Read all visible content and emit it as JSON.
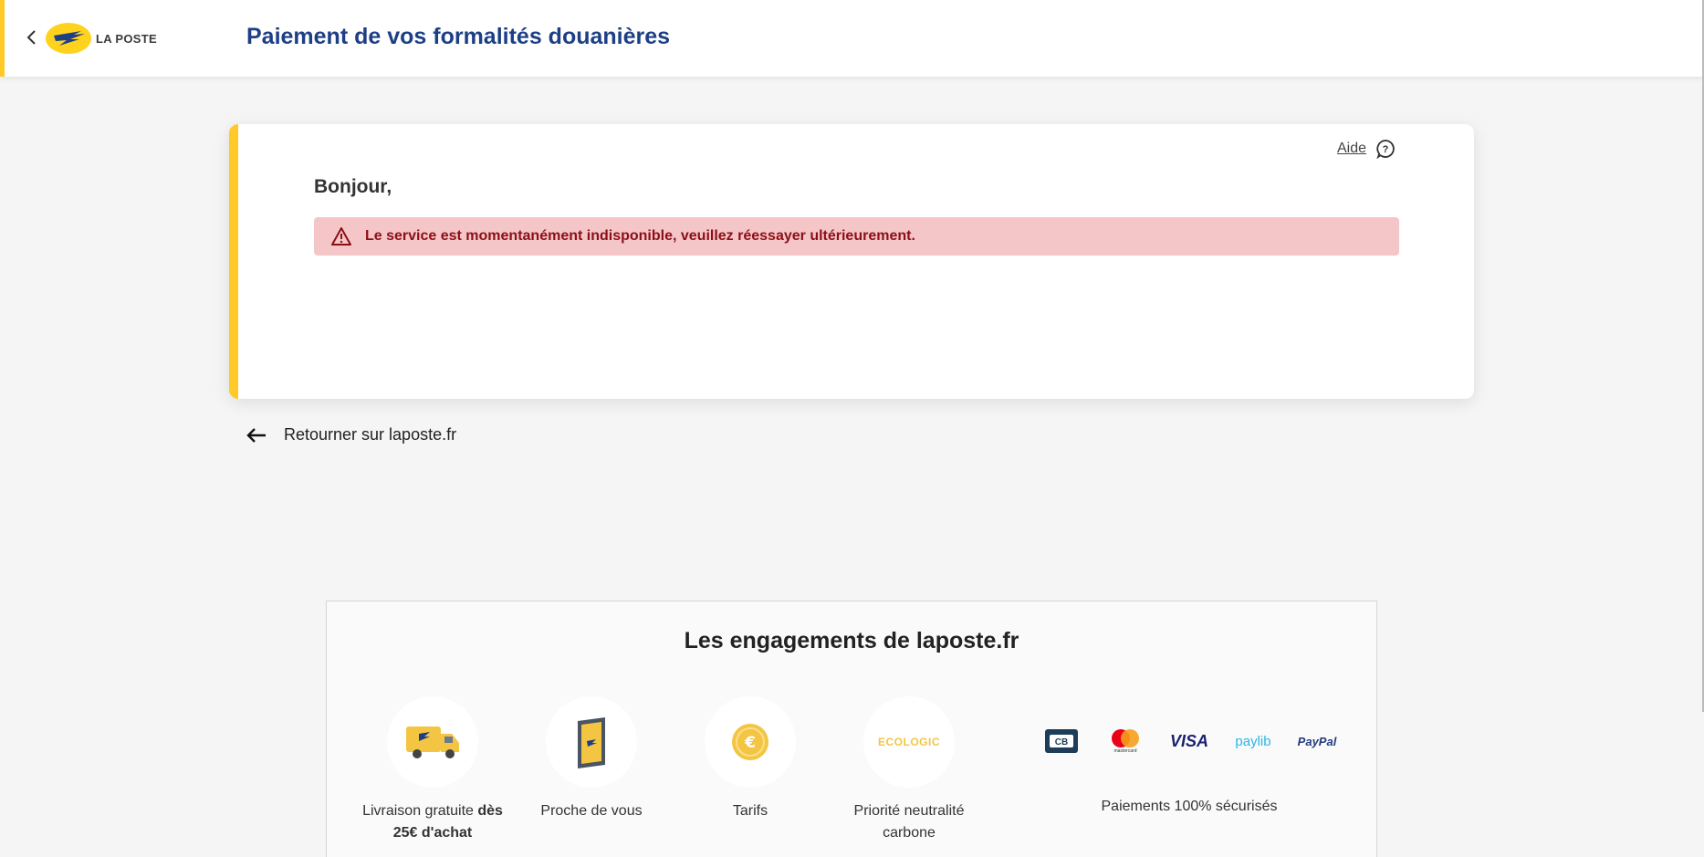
{
  "header": {
    "logo_text": "LA POSTE",
    "title": "Paiement de vos formalités douanières"
  },
  "card": {
    "help_label": "Aide",
    "greeting": "Bonjour,",
    "alert_message": "Le service est momentanément indisponible, veuillez réessayer ultérieurement."
  },
  "back_link": {
    "label": "Retourner sur laposte.fr"
  },
  "engagements": {
    "title": "Les engagements de laposte.fr",
    "items": [
      {
        "label_main": "Livraison gratuite ",
        "label_bold": "dès 25€ d'achat",
        "icon": "delivery-truck-icon"
      },
      {
        "label_main": "Proche de vous",
        "icon": "tablet-icon"
      },
      {
        "label_main": "Tarifs",
        "icon": "euro-coin-icon"
      },
      {
        "label_main": "Priorité neutralité carbone",
        "icon": "ecologic-icon",
        "icon_text": "ECOLOGIC"
      }
    ],
    "payments": {
      "logos": [
        "CB",
        "mastercard",
        "VISA",
        "paylib",
        "PayPal"
      ],
      "label": "Paiements 100% sécurisés"
    }
  },
  "colors": {
    "accent_yellow": "#ffc928",
    "title_blue": "#1d3f86",
    "alert_bg": "#f5c6c8",
    "alert_text": "#8b0f16"
  }
}
